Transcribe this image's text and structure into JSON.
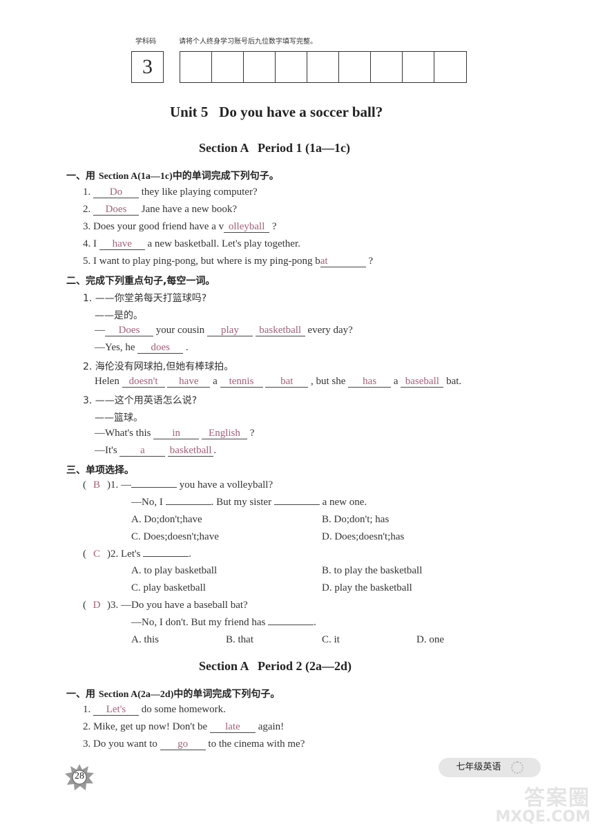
{
  "header": {
    "subject_code_label": "学科码",
    "instruction": "请将个人终身学习账号后九位数字填写完整。",
    "subject_code": "3"
  },
  "unit_title": "Unit 5   Do you have a soccer ball?",
  "section1": {
    "title": "Section A   Period 1 (1a—1c)",
    "part1": {
      "heading_prefix": "一、用 ",
      "heading_bold": "Section A(1a—1c)",
      "heading_suffix": "中的单词完成下列句子。",
      "q1": {
        "num": "1. ",
        "ans": "Do",
        "rest": " they like playing computer?"
      },
      "q2": {
        "num": "2. ",
        "ans": "Does",
        "rest": " Jane have a new book?"
      },
      "q3": {
        "pre": "3. Does your good friend have a v",
        "ans": "olleyball",
        "rest": " ?"
      },
      "q4": {
        "num": "4. I ",
        "ans": "have",
        "rest": " a new basketball. Let's play together."
      },
      "q5": {
        "pre": "5. I want to play ping-pong, but where is my ping-pong b",
        "ans": "at",
        "rest": " ?"
      }
    },
    "part2": {
      "heading": "二、完成下列重点句子,每空一词。",
      "q1": {
        "cn1": "1. ——你堂弟每天打篮球吗?",
        "cn2": "——是的。",
        "e1_pre": "—",
        "e1_a1": "Does",
        "e1_mid": " your cousin ",
        "e1_a2": "play",
        "e1_a3": "basketball",
        "e1_post": " every day?",
        "e2_pre": "—Yes, he ",
        "e2_a1": "does",
        "e2_post": " ."
      },
      "q2": {
        "cn": "2. 海伦没有网球拍,但她有棒球拍。",
        "pre": "Helen ",
        "a1": "doesn't",
        "a2": "have",
        "m1": " a ",
        "a3": "tennis",
        "a4": "bat",
        "m2": " , but she ",
        "a5": "has",
        "m3": " a ",
        "a6": "baseball",
        "post": " bat."
      },
      "q3": {
        "cn1": "3. ——这个用英语怎么说?",
        "cn2": "——篮球。",
        "e1_pre": "—What's this ",
        "e1_a1": "in",
        "e1_a2": "English",
        "e1_post": " ?",
        "e2_pre": "—It's ",
        "e2_a1": "a",
        "e2_a2": "basketball",
        "e2_post": "."
      }
    },
    "part3": {
      "heading": "三、单项选择。",
      "questions": [
        {
          "answer": "B",
          "num": ")1. —",
          "stem1_post": " you have a volleyball?",
          "stem2_pre": "—No, I ",
          "stem2_mid": ". But my sister ",
          "stem2_post": " a new one.",
          "options": [
            "A. Do;don't;have",
            "B. Do;don't; has",
            "C. Does;doesn't;have",
            "D. Does;doesn't;has"
          ]
        },
        {
          "answer": "C",
          "num": ")2. Let's ",
          "stem1_post": ".",
          "options": [
            "A. to play basketball",
            "B. to play the basketball",
            "C. play basketball",
            "D. play the basketball"
          ]
        },
        {
          "answer": "D",
          "num": ")3. —Do you have a baseball bat?",
          "stem2_pre": "—No, I don't. But my friend has ",
          "stem2_post": ".",
          "options": [
            "A. this",
            "B. that",
            "C. it",
            "D. one"
          ]
        }
      ]
    }
  },
  "section2": {
    "title": "Section A   Period 2 (2a—2d)",
    "part1": {
      "heading_prefix": "一、用 ",
      "heading_bold": "Section A(2a—2d)",
      "heading_suffix": "中的单词完成下列句子。",
      "q1": {
        "num": "1. ",
        "ans": "Let's",
        "rest": " do some homework."
      },
      "q2": {
        "pre": "2. Mike, get up now! Don't be ",
        "ans": "late",
        "rest": " again!"
      },
      "q3": {
        "pre": "3. Do you want to ",
        "ans": "go",
        "rest": " to the cinema with me?"
      }
    }
  },
  "footer": {
    "page_number": "28",
    "book_tag": "七年级英语",
    "watermark_top": "答案圈",
    "watermark_bottom": "MXQE.COM"
  }
}
